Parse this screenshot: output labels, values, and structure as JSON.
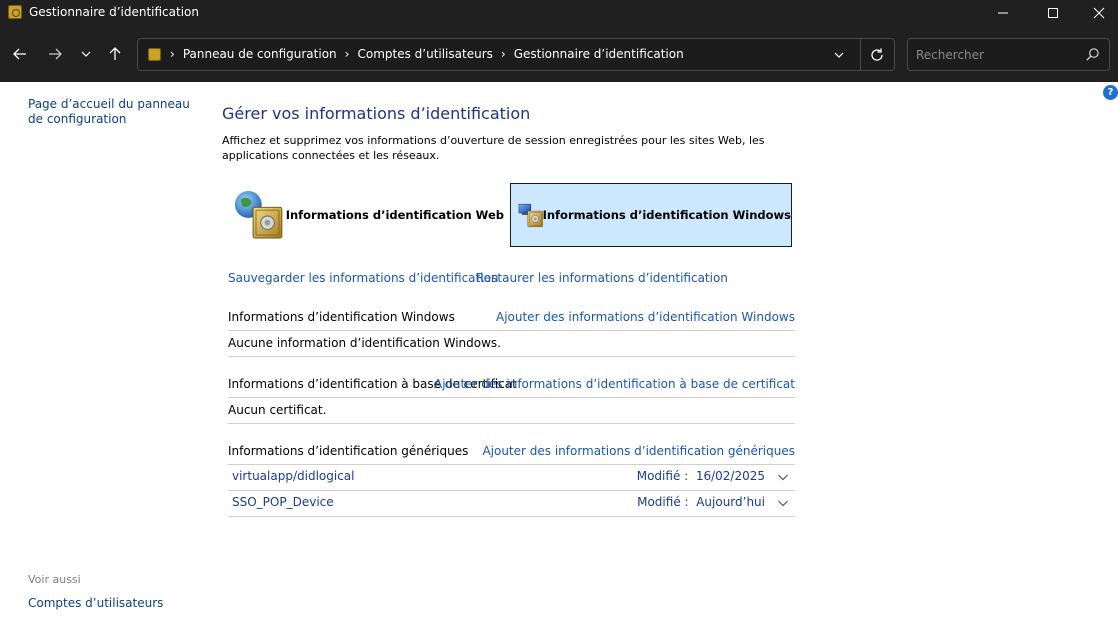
{
  "window": {
    "title": "Gestionnaire d’identification"
  },
  "address": {
    "crumbs": [
      "Panneau de configuration",
      "Comptes d’utilisateurs",
      "Gestionnaire d’identification"
    ],
    "search_placeholder": "Rechercher"
  },
  "sidebar": {
    "home_link": "Page d’accueil du panneau de configuration",
    "see_also_label": "Voir aussi",
    "see_also_link": "Comptes d’utilisateurs"
  },
  "main": {
    "title": "Gérer vos informations d’identification",
    "description": "Affichez et supprimez vos informations d’ouverture de session enregistrées pour les sites Web, les applications connectées et les réseaux.",
    "tiles": {
      "web": "Informations d’identification Web",
      "windows": "Informations d’identification Windows"
    },
    "backup_link": "Sauvegarder les informations d’identification",
    "restore_link": "Restaurer les informations d’identification",
    "sections": {
      "windows": {
        "label": "Informations d’identification Windows",
        "add_link": "Ajouter des informations d’identification Windows",
        "empty": "Aucune information d’identification Windows."
      },
      "certificate": {
        "label": "Informations d’identification à base de certificat",
        "add_link": "Ajouter des informations d’identification à base de certificat",
        "empty": "Aucun certificat."
      },
      "generic": {
        "label": "Informations d’identification génériques",
        "add_link": "Ajouter des informations d’identification génériques",
        "items": [
          {
            "name": "virtualapp/didlogical",
            "modified_label": "Modifié :",
            "modified_value": "16/02/2025"
          },
          {
            "name": "SSO_POP_Device",
            "modified_label": "Modifié :",
            "modified_value": "Aujourd’hui"
          }
        ]
      }
    }
  },
  "colors": {
    "titlebar": "#202020",
    "link": "#1a56b0",
    "title": "#1e3287",
    "tile_selected": "#cce8ff"
  }
}
